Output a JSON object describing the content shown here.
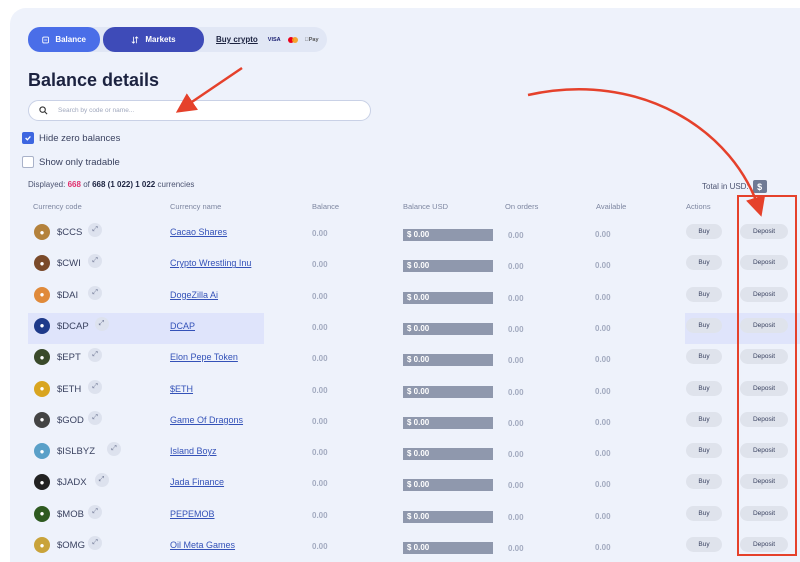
{
  "topbar": {
    "balance_label": "Balance",
    "markets_label": "Markets",
    "buy_crypto_label": "Buy crypto",
    "visa": "VISA",
    "applepay": "Pay"
  },
  "page_title": "Balance details",
  "search": {
    "placeholder": "Search by code or name..."
  },
  "filters": {
    "hide_zero": {
      "label": "Hide zero balances",
      "checked": true
    },
    "tradable": {
      "label": "Show only tradable",
      "checked": false
    }
  },
  "summary": {
    "prefix": "Displayed:",
    "shown": "668",
    "of": "of",
    "total": "668 (1 022) 1 022",
    "suffix": "currencies",
    "total_in_label": "Total in USD:",
    "currency_symbol": "$"
  },
  "columns": {
    "code": "Currency code",
    "name": "Currency name",
    "balance": "Balance",
    "balance_usd": "Balance USD",
    "on_orders": "On orders",
    "available": "Available",
    "actions": "Actions"
  },
  "rows": [
    {
      "code": "$CCS",
      "name": "Cacao Shares",
      "balance": "0.00",
      "usd": "$ 0.00",
      "orders": "0.00",
      "available": "0.00",
      "buy": "Buy",
      "deposit": "Deposit",
      "coin_color": "#b4823c",
      "icon": "cacao-coin-icon"
    },
    {
      "code": "$CWI",
      "name": "Crypto Wrestling Inu",
      "balance": "0.00",
      "usd": "$ 0.00",
      "orders": "0.00",
      "available": "0.00",
      "buy": "Buy",
      "deposit": "Deposit",
      "coin_color": "#7a4a2a",
      "icon": "wrestling-dog-icon"
    },
    {
      "code": "$DAI",
      "name": "DogeZilla Ai",
      "balance": "0.00",
      "usd": "$ 0.00",
      "orders": "0.00",
      "available": "0.00",
      "buy": "Buy",
      "deposit": "Deposit",
      "coin_color": "#e08a3a",
      "icon": "dogezilla-icon"
    },
    {
      "code": "$DCAP",
      "name": "DCAP",
      "balance": "0.00",
      "usd": "$ 0.00",
      "orders": "0.00",
      "available": "0.00",
      "buy": "Buy",
      "deposit": "Deposit",
      "coin_color": "#1e3a8a",
      "icon": "dcap-logo-icon",
      "highlight": true
    },
    {
      "code": "$EPT",
      "name": "Elon Pepe Token",
      "balance": "0.00",
      "usd": "$ 0.00",
      "orders": "0.00",
      "available": "0.00",
      "buy": "Buy",
      "deposit": "Deposit",
      "coin_color": "#3a4a2a",
      "icon": "pepe-icon"
    },
    {
      "code": "$ETH",
      "name": "$ETH",
      "balance": "0.00",
      "usd": "$ 0.00",
      "orders": "0.00",
      "available": "0.00",
      "buy": "Buy",
      "deposit": "Deposit",
      "coin_color": "#d9a520",
      "icon": "eth-coin-icon"
    },
    {
      "code": "$GOD",
      "name": "Game Of Dragons",
      "balance": "0.00",
      "usd": "$ 0.00",
      "orders": "0.00",
      "available": "0.00",
      "buy": "Buy",
      "deposit": "Deposit",
      "coin_color": "#444444",
      "icon": "dragon-icon"
    },
    {
      "code": "$ISLBYZ",
      "name": "Island Boyz",
      "balance": "0.00",
      "usd": "$ 0.00",
      "orders": "0.00",
      "available": "0.00",
      "buy": "Buy",
      "deposit": "Deposit",
      "coin_color": "#5aa0c8",
      "icon": "island-boyz-icon"
    },
    {
      "code": "$JADX",
      "name": "Jada Finance",
      "balance": "0.00",
      "usd": "$ 0.00",
      "orders": "0.00",
      "available": "0.00",
      "buy": "Buy",
      "deposit": "Deposit",
      "coin_color": "#222222",
      "icon": "crown-icon"
    },
    {
      "code": "$MOB",
      "name": "PEPEMOB",
      "balance": "0.00",
      "usd": "$ 0.00",
      "orders": "0.00",
      "available": "0.00",
      "buy": "Buy",
      "deposit": "Deposit",
      "coin_color": "#2e5a20",
      "icon": "pepemob-icon"
    },
    {
      "code": "$OMG",
      "name": "Oil Meta Games",
      "balance": "0.00",
      "usd": "$ 0.00",
      "orders": "0.00",
      "available": "0.00",
      "buy": "Buy",
      "deposit": "Deposit",
      "coin_color": "#c9a33a",
      "icon": "oil-coin-icon"
    }
  ],
  "colors": {
    "accent": "#4a6ee8",
    "markets": "#3e4bb8",
    "annotation_red": "#e5412b",
    "usd_bar": "#8f98ad"
  }
}
